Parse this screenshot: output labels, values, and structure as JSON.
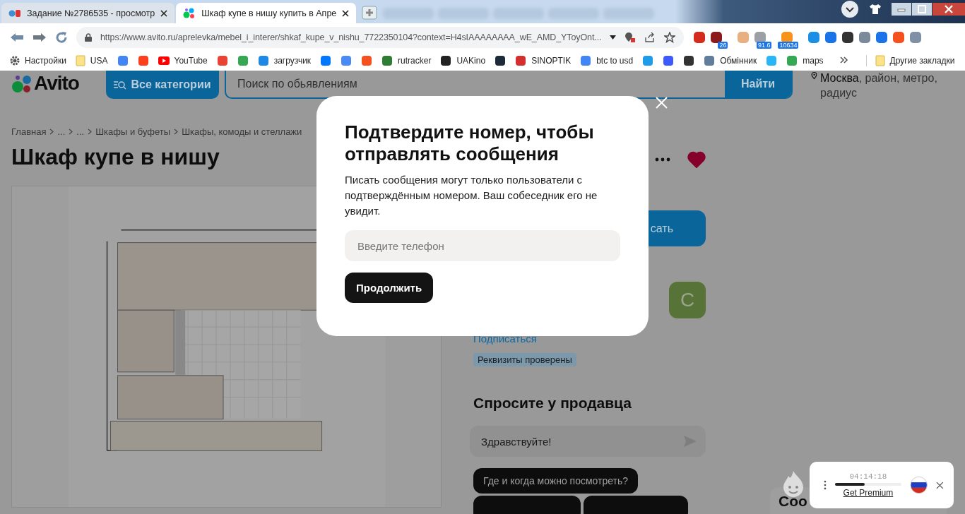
{
  "browser": {
    "tabs": [
      {
        "title": "Задание №2786535 - просмотр",
        "selected": false,
        "kind": "sp"
      },
      {
        "title": "Шкаф купе в нишу купить в Апре",
        "selected": true,
        "kind": "avito"
      }
    ],
    "address": "https://www.avito.ru/aprelevka/mebel_i_interer/shkaf_kupe_v_nishu_7722350104?context=H4sIAAAAAAAA_wE_AMD_YToyOnt...",
    "extensions": [
      {
        "color": "#d52b1e"
      },
      {
        "color": "#8b1a1a",
        "badge": "26"
      },
      {
        "color": "#e8b080"
      },
      {
        "color": "#9aa0a6",
        "badge": "91.6"
      },
      {
        "color": "#f7931a",
        "badge": "10634"
      },
      {
        "color": "#1a8fe3"
      },
      {
        "color": "#1a73e8"
      },
      {
        "color": "#333333"
      },
      {
        "color": "#7b8a9a"
      },
      {
        "color": "#1a73e8"
      },
      {
        "color": "#f4511e"
      },
      {
        "color": "#7f8fa6"
      }
    ],
    "bookmarks": [
      {
        "kind": "gear",
        "label": "Настройки"
      },
      {
        "kind": "folder",
        "label": "USA"
      },
      {
        "kind": "site",
        "color": "#4285f4"
      },
      {
        "kind": "site",
        "color": "#fc3f1d"
      },
      {
        "kind": "play",
        "label": "YouTube"
      },
      {
        "kind": "site",
        "color": "#ea4335"
      },
      {
        "kind": "site",
        "color": "#34a853"
      },
      {
        "kind": "site",
        "color": "#1e88e5",
        "label": "загрузчик"
      },
      {
        "kind": "site",
        "color": "#0077ff"
      },
      {
        "kind": "site",
        "color": "#4a8af4"
      },
      {
        "kind": "site",
        "color": "#f4511e"
      },
      {
        "kind": "site",
        "color": "#2e7d32",
        "label": "rutracker"
      },
      {
        "kind": "site",
        "color": "#222222",
        "label": "UAKino"
      },
      {
        "kind": "site",
        "color": "#1c2a3a"
      },
      {
        "kind": "site",
        "color": "#d32f2f",
        "label": "SINOPTIK"
      },
      {
        "kind": "site",
        "color": "#4285f4",
        "label": "btc to usd"
      },
      {
        "kind": "site",
        "color": "#1e9be9"
      },
      {
        "kind": "site",
        "color": "#3d5afe"
      },
      {
        "kind": "site",
        "color": "#333333"
      },
      {
        "kind": "site",
        "color": "#607d9b",
        "label": "Обмінник"
      },
      {
        "kind": "site",
        "color": "#29b6f6"
      },
      {
        "kind": "site",
        "color": "#34a853",
        "label": "maps"
      }
    ],
    "other_bookmarks": "Другие закладки"
  },
  "header": {
    "logo": "Avito",
    "categories_button": "Все категории",
    "search_placeholder": "Поиск по обьявлениям",
    "search_button": "Найти",
    "location": "Москва",
    "location_hint": ", район, метро, радиус"
  },
  "breadcrumbs": [
    "Главная",
    "...",
    "...",
    "Шкафы и буфеты",
    "Шкафы, комоды и стеллажи"
  ],
  "title": "Шкаф купе в нишу",
  "seller": {
    "favorite": true,
    "write_button": "сать",
    "avatar_letter": "С",
    "subscribe_link": "Подписаться",
    "badge": "Реквизиты проверены"
  },
  "ask": {
    "heading": "Спросите у продавца",
    "message": "Здравствуйте!",
    "chips": [
      "Где и когда можно посмотреть?"
    ]
  },
  "side_card": {
    "heading": "Соо"
  },
  "modal": {
    "title": "Подтвердите номер, чтобы отправлять сообщения",
    "text": "Писать сообщения могут только пользователи с подтверждённым номером. Ваш собеседник его не увидит.",
    "phone_placeholder": "Введите телефон",
    "continue_button": "Продолжить"
  },
  "vpn": {
    "time": "04:14:18",
    "level": 0.45,
    "link": "Get Premium"
  }
}
